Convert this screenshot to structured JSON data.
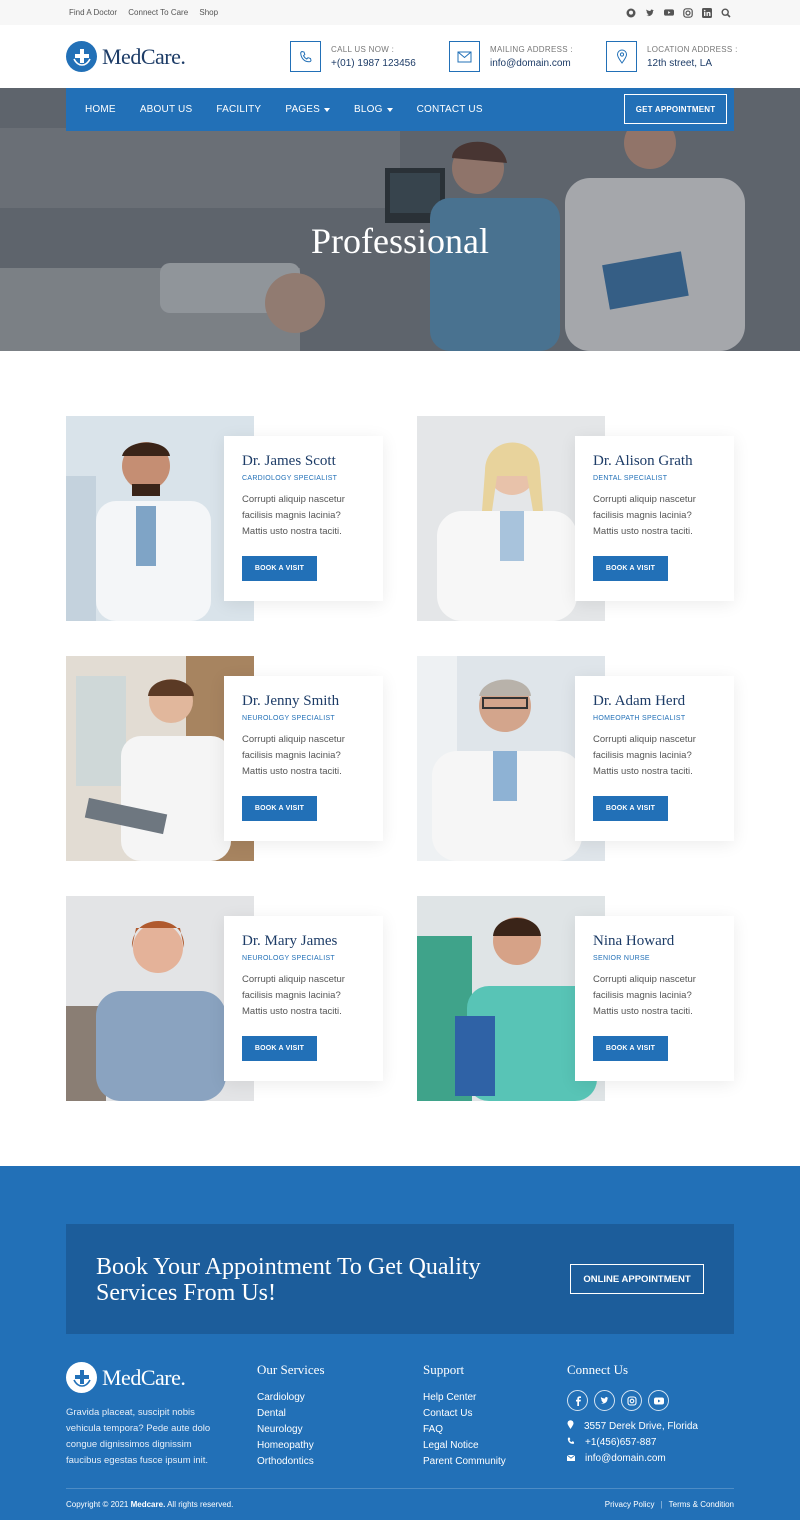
{
  "topbar": {
    "links": [
      "Find A Doctor",
      "Connect To Care",
      "Shop"
    ],
    "social_icons": [
      "github-icon",
      "twitter-icon",
      "youtube-icon",
      "instagram-icon",
      "linkedin-icon",
      "search-icon"
    ]
  },
  "header": {
    "logo_text": "MedCare.",
    "call": {
      "label": "CALL US NOW :",
      "value": "+(01) 1987 123456"
    },
    "mail": {
      "label": "MAILING ADDRESS :",
      "value": "info@domain.com"
    },
    "location": {
      "label": "LOCATION ADDRESS :",
      "value": "12th street, LA"
    }
  },
  "nav": {
    "items": [
      {
        "label": "HOME"
      },
      {
        "label": "ABOUT US"
      },
      {
        "label": "FACILITY"
      },
      {
        "label": "PAGES"
      },
      {
        "label": "BLOG"
      },
      {
        "label": "CONTACT US"
      }
    ],
    "cta": "GET APPOINTMENT"
  },
  "hero": {
    "title": "Professional"
  },
  "doctors": [
    {
      "name": "Dr. James Scott",
      "role": "CARDIOLOGY SPECIALIST",
      "desc": "Corrupti aliquip nascetur facilisis magnis lacinia? Mattis usto nostra taciti.",
      "button": "BOOK A VISIT"
    },
    {
      "name": "Dr. Alison Grath",
      "role": "DENTAL SPECIALIST",
      "desc": "Corrupti aliquip nascetur facilisis magnis lacinia? Mattis usto nostra taciti.",
      "button": "BOOK A VISIT"
    },
    {
      "name": "Dr. Jenny Smith",
      "role": "NEUROLOGY SPECIALIST",
      "desc": "Corrupti aliquip nascetur facilisis magnis lacinia? Mattis usto nostra taciti.",
      "button": "BOOK A VISIT"
    },
    {
      "name": "Dr. Adam Herd",
      "role": "HOMEOPATH SPECIALIST",
      "desc": "Corrupti aliquip nascetur facilisis magnis lacinia? Mattis usto nostra taciti.",
      "button": "BOOK A VISIT"
    },
    {
      "name": "Dr. Mary James",
      "role": "NEUROLOGY SPECIALIST",
      "desc": "Corrupti aliquip nascetur facilisis magnis lacinia? Mattis usto nostra taciti.",
      "button": "BOOK A VISIT"
    },
    {
      "name": "Nina Howard",
      "role": "SENIOR NURSE",
      "desc": "Corrupti aliquip nascetur facilisis magnis lacinia? Mattis usto nostra taciti.",
      "button": "BOOK A VISIT"
    }
  ],
  "cta": {
    "title": "Book Your Appointment To Get Quality Services From Us!",
    "button": "ONLINE APPOINTMENT"
  },
  "footer": {
    "logo_text": "MedCare.",
    "about": "Gravida placeat, suscipit nobis vehicula tempora? Pede aute dolo congue dignissimos dignissim faucibus egestas fusce ipsum init.",
    "services": {
      "title": "Our Services",
      "items": [
        "Cardiology",
        "Dental",
        "Neurology",
        "Homeopathy",
        "Orthodontics"
      ]
    },
    "support": {
      "title": "Support",
      "items": [
        "Help Center",
        "Contact Us",
        "FAQ",
        "Legal Notice",
        "Parent Community"
      ]
    },
    "connect": {
      "title": "Connect Us",
      "address": "3557 Derek Drive, Florida",
      "phone": "+1(456)657-887",
      "email": "info@domain.com"
    },
    "copyright_prefix": "Copyright © 2021 ",
    "copyright_brand": "Medcare.",
    "copyright_suffix": " All rights reserved.",
    "privacy": "Privacy Policy",
    "separator": "|",
    "terms": "Terms & Condition"
  },
  "colors": {
    "primary": "#2270b7",
    "dark_navy": "#1d3c67",
    "cta_bg": "#1c5d9b"
  }
}
